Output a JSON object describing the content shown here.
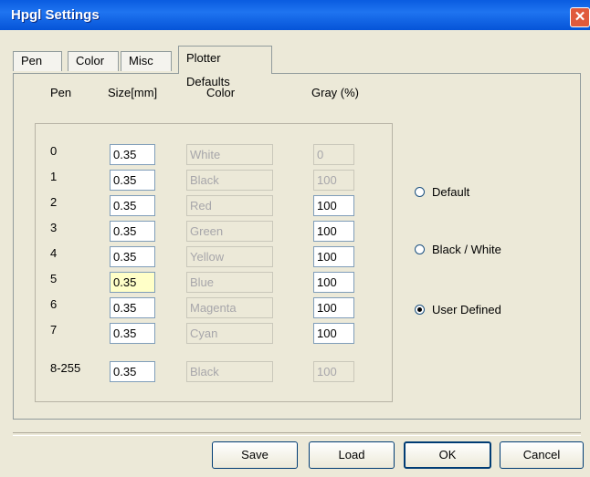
{
  "window": {
    "title": "Hpgl Settings",
    "close_glyph": "✕"
  },
  "tabs": [
    {
      "label": "Pen",
      "active": false
    },
    {
      "label": "Color",
      "active": false
    },
    {
      "label": "Misc",
      "active": false
    },
    {
      "label": "Plotter Defaults",
      "active": true
    }
  ],
  "columns": {
    "pen": "Pen",
    "size": "Size[mm]",
    "color": "Color",
    "gray": "Gray (%)"
  },
  "rows": [
    {
      "pen": "0",
      "size": "0.35",
      "color": "White",
      "gray": "0",
      "gray_disabled": true
    },
    {
      "pen": "1",
      "size": "0.35",
      "color": "Black",
      "gray": "100",
      "gray_disabled": true
    },
    {
      "pen": "2",
      "size": "0.35",
      "color": "Red",
      "gray": "100",
      "gray_disabled": false
    },
    {
      "pen": "3",
      "size": "0.35",
      "color": "Green",
      "gray": "100",
      "gray_disabled": false
    },
    {
      "pen": "4",
      "size": "0.35",
      "color": "Yellow",
      "gray": "100",
      "gray_disabled": false
    },
    {
      "pen": "5",
      "size": "0.35",
      "color": "Blue",
      "gray": "100",
      "gray_disabled": false
    },
    {
      "pen": "6",
      "size": "0.35",
      "color": "Magenta",
      "gray": "100",
      "gray_disabled": false
    },
    {
      "pen": "7",
      "size": "0.35",
      "color": "Cyan",
      "gray": "100",
      "gray_disabled": false
    },
    {
      "pen": "8-255",
      "size": "0.35",
      "color": "Black",
      "gray": "100",
      "gray_disabled": true
    }
  ],
  "radios": [
    {
      "label": "Default",
      "checked": false
    },
    {
      "label": "Black / White",
      "checked": false
    },
    {
      "label": "User Defined",
      "checked": true
    }
  ],
  "buttons": {
    "save": "Save",
    "load": "Load",
    "ok": "OK",
    "cancel": "Cancel"
  }
}
